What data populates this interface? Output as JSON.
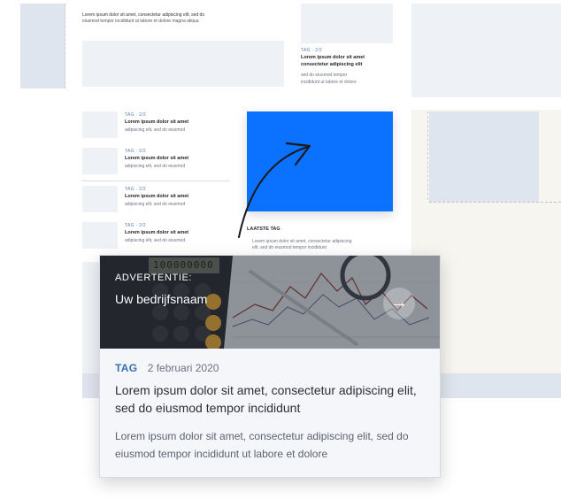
{
  "background_articles": [
    {
      "tag": "TAG · 2/2",
      "title": "Lorem ipsum dolor sit amet",
      "excerpt": "adipiscing elit, sed do eiusmod"
    },
    {
      "tag": "TAG · 2/2",
      "title": "Lorem ipsum dolor sit amet",
      "excerpt": "adipiscing elit, sed do eiusmod"
    },
    {
      "tag": "TAG · 2/2",
      "title": "Lorem ipsum dolor sit amet",
      "excerpt": "adipiscing elit, sed do eiusmod"
    },
    {
      "tag": "TAG · 2/2",
      "title": "Lorem ipsum dolor sit amet",
      "excerpt": "adipiscing elit, sed do eiusmod"
    }
  ],
  "top_text": {
    "line1": "Lorem ipsum dolor sit amet, consectetur adipiscing elit, sed do",
    "line2": "eiusmod tempor incididunt ut labore et dolore magna aliqua"
  },
  "side_article": {
    "tag": "TAG · 2/2",
    "title_line1": "Lorem ipsum dolor sit amet",
    "title_line2": "consectetur adipiscing elit",
    "excerpt_line1": "sed do eiusmod tempor",
    "excerpt_line2": "incididunt ut labore et dolore"
  },
  "mid_article": {
    "tag": "LAATSTE TAG",
    "excerpt_line1": "Lorem ipsum dolor sit amet, consectetur adipiscing",
    "excerpt_line2": "elit, sed do eiusmod tempor incididunt"
  },
  "featured_card": {
    "overlay_label": "ADVERTENTIE:",
    "overlay_name": "Uw bedrijfsnaam",
    "tag": "TAG",
    "date": "2 februari 2020",
    "title": "Lorem ipsum dolor sit amet, consectetur adipiscing elit, sed do eiusmod tempor incididunt",
    "excerpt": "Lorem ipsum dolor sit amet, consectetur adipiscing elit, sed do eiusmod tempor incididunt ut labore et dolore",
    "calculator_display": "100000000"
  },
  "colors": {
    "highlight_blue": "#0a72ff",
    "tag_blue": "#3a6fb0",
    "placeholder": "#eef1f6"
  },
  "icons": [
    "arrow-right-icon",
    "curved-pointer-arrow-icon"
  ]
}
